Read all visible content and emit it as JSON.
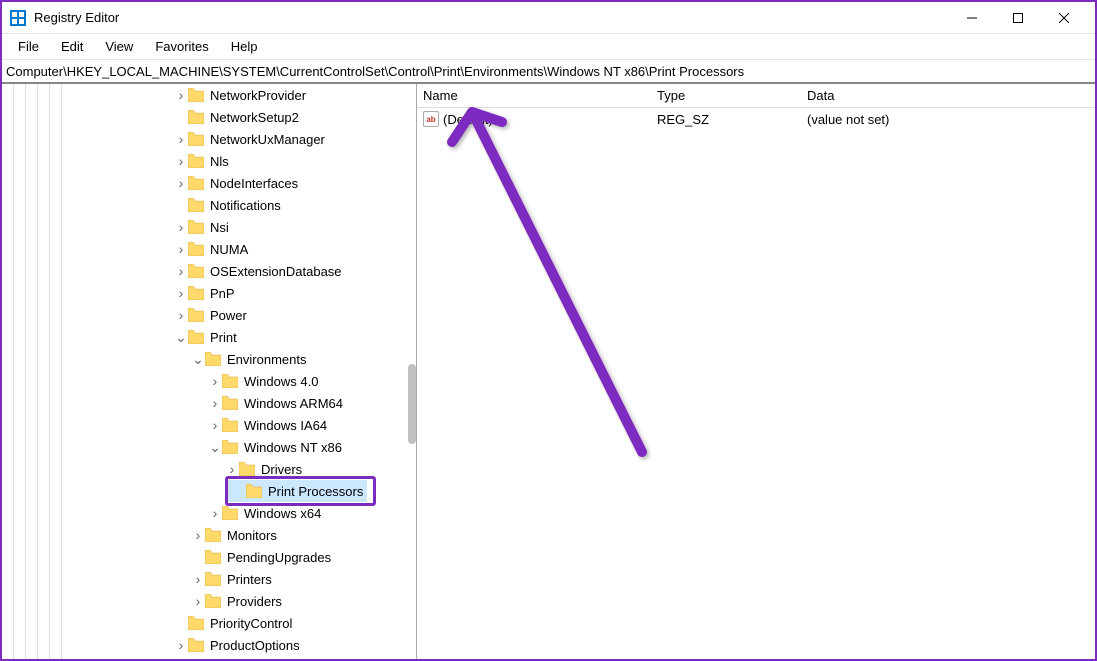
{
  "title": "Registry Editor",
  "menu": {
    "file": "File",
    "edit": "Edit",
    "view": "View",
    "favorites": "Favorites",
    "help": "Help"
  },
  "address": "Computer\\HKEY_LOCAL_MACHINE\\SYSTEM\\CurrentControlSet\\Control\\Print\\Environments\\Windows NT x86\\Print Processors",
  "columns": {
    "name": "Name",
    "type": "Type",
    "data": "Data"
  },
  "value_row": {
    "name": "(Default)",
    "type": "REG_SZ",
    "data": "(value not set)"
  },
  "tree": {
    "items": [
      {
        "depth": 6,
        "exp": ">",
        "label": "NetworkProvider"
      },
      {
        "depth": 6,
        "exp": "",
        "label": "NetworkSetup2"
      },
      {
        "depth": 6,
        "exp": ">",
        "label": "NetworkUxManager"
      },
      {
        "depth": 6,
        "exp": ">",
        "label": "Nls"
      },
      {
        "depth": 6,
        "exp": ">",
        "label": "NodeInterfaces"
      },
      {
        "depth": 6,
        "exp": "",
        "label": "Notifications"
      },
      {
        "depth": 6,
        "exp": ">",
        "label": "Nsi"
      },
      {
        "depth": 6,
        "exp": ">",
        "label": "NUMA"
      },
      {
        "depth": 6,
        "exp": ">",
        "label": "OSExtensionDatabase"
      },
      {
        "depth": 6,
        "exp": ">",
        "label": "PnP"
      },
      {
        "depth": 6,
        "exp": ">",
        "label": "Power"
      },
      {
        "depth": 6,
        "exp": "v",
        "label": "Print"
      },
      {
        "depth": 7,
        "exp": "v",
        "label": "Environments"
      },
      {
        "depth": 8,
        "exp": ">",
        "label": "Windows 4.0"
      },
      {
        "depth": 8,
        "exp": ">",
        "label": "Windows ARM64"
      },
      {
        "depth": 8,
        "exp": ">",
        "label": "Windows IA64"
      },
      {
        "depth": 8,
        "exp": "v",
        "label": "Windows NT x86"
      },
      {
        "depth": 9,
        "exp": ">",
        "label": "Drivers"
      },
      {
        "depth": 9,
        "exp": "",
        "label": "Print Processors",
        "selected": true
      },
      {
        "depth": 8,
        "exp": ">",
        "label": "Windows x64"
      },
      {
        "depth": 7,
        "exp": ">",
        "label": "Monitors"
      },
      {
        "depth": 7,
        "exp": "",
        "label": "PendingUpgrades"
      },
      {
        "depth": 7,
        "exp": ">",
        "label": "Printers"
      },
      {
        "depth": 7,
        "exp": ">",
        "label": "Providers"
      },
      {
        "depth": 6,
        "exp": "",
        "label": "PriorityControl"
      },
      {
        "depth": 6,
        "exp": ">",
        "label": "ProductOptions"
      }
    ]
  }
}
